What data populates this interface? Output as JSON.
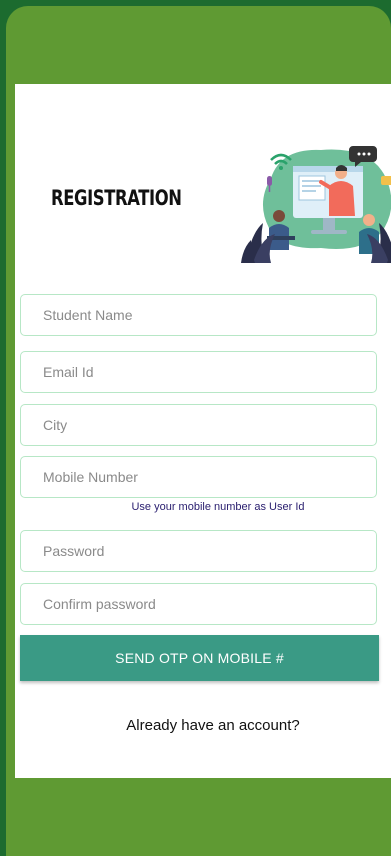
{
  "page": {
    "title": "REGISTRATION",
    "colors": {
      "outer": "#1c6b2f",
      "phone": "#5f9a33",
      "field_border": "#b7e7c6",
      "button": "#3a9a85"
    }
  },
  "form": {
    "fields": [
      {
        "placeholder": "Student Name"
      },
      {
        "placeholder": "Email Id"
      },
      {
        "placeholder": "City"
      },
      {
        "placeholder": "Mobile Number"
      },
      {
        "placeholder": "Password"
      },
      {
        "placeholder": "Confirm password"
      }
    ],
    "mobile_hint": "Use your mobile number as User Id",
    "submit_label": "SEND OTP ON MOBILE #",
    "login_link": "Already have an account?"
  },
  "illustration": {
    "icon": "online-teaching-illustration"
  }
}
